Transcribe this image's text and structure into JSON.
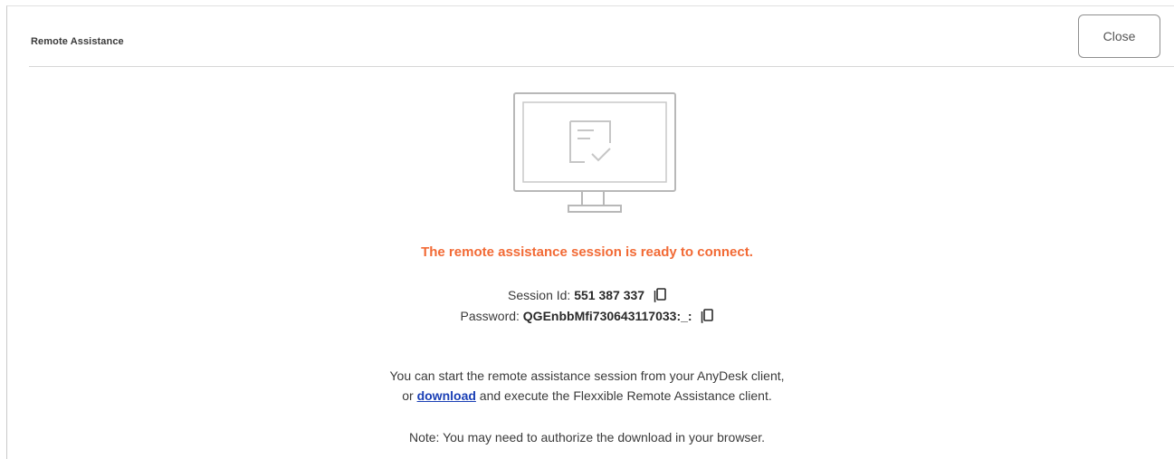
{
  "header": {
    "title": "Remote Assistance",
    "close_label": "Close"
  },
  "status": {
    "message": "The remote assistance session is ready to connect.",
    "color": "#f26a35"
  },
  "session": {
    "id_label": "Session Id:",
    "id_value": "551 387 337",
    "password_label": "Password:",
    "password_value": "QGEnbbMfi730643117033:_:"
  },
  "info": {
    "line1": "You can start the remote assistance session from your AnyDesk client,",
    "line2_prefix": "or",
    "download_label": "download",
    "line2_suffix": "and execute the Flexxible Remote Assistance client.",
    "note": "Note: You may need to authorize the download in your browser."
  },
  "icons": {
    "monitor": "monitor-icon",
    "copy": "copy-icon"
  },
  "colors": {
    "accent": "#f26a35",
    "link": "#1a3fb5"
  }
}
